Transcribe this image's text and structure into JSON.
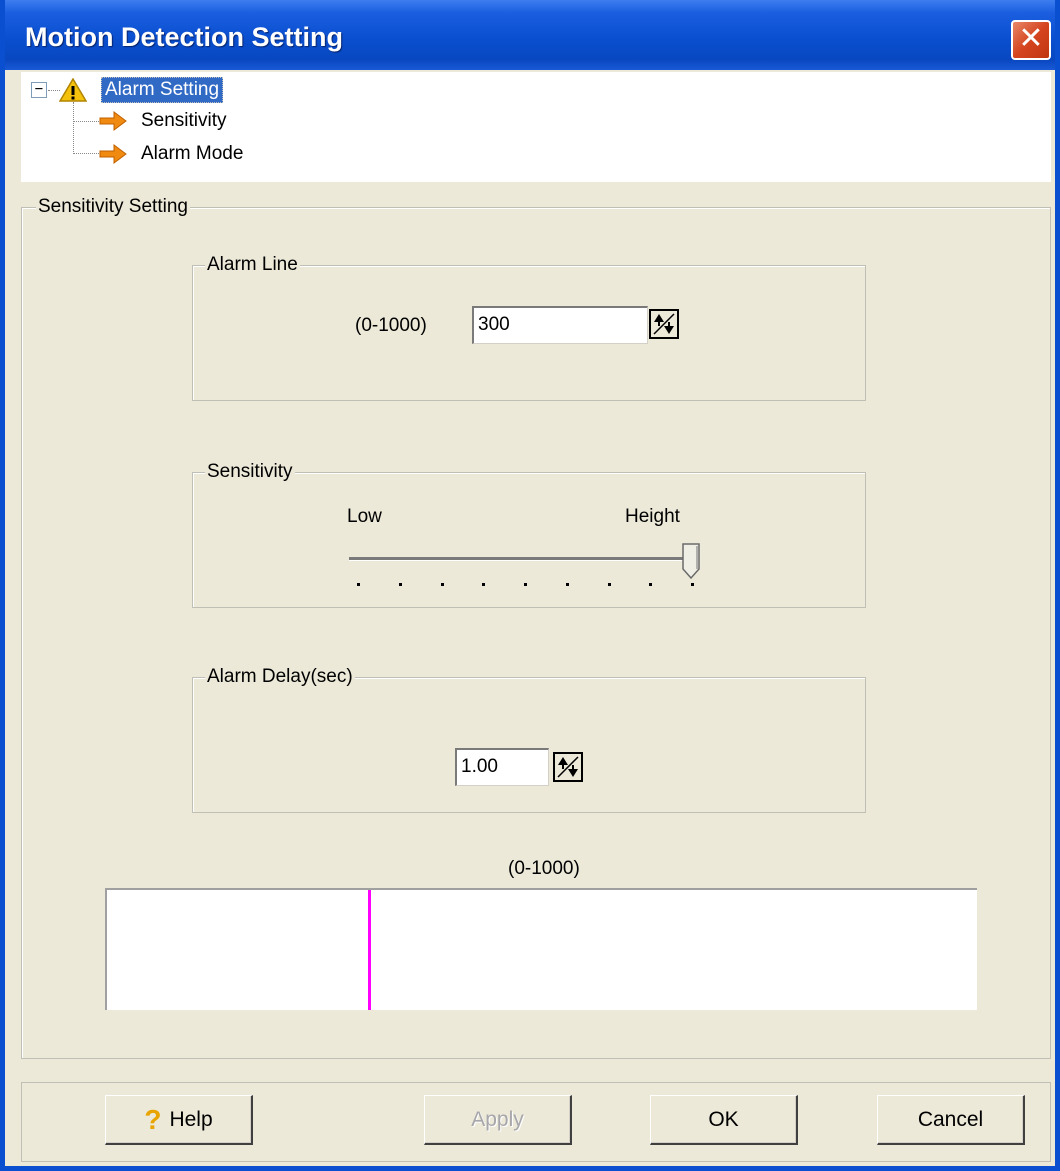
{
  "window": {
    "title": "Motion Detection Setting",
    "close_label": "✕"
  },
  "tree": {
    "expand_symbol": "−",
    "root": {
      "label": "Alarm Setting",
      "icon": "warning-icon"
    },
    "children": [
      {
        "label": "Sensitivity",
        "icon": "arrow-right-icon"
      },
      {
        "label": "Alarm Mode",
        "icon": "arrow-right-icon"
      }
    ]
  },
  "sensitivity_setting": {
    "title": "Sensitivity Setting",
    "alarm_line": {
      "label": "Alarm Line",
      "range": "(0-1000)",
      "value": "300"
    },
    "sensitivity": {
      "label": "Sensitivity",
      "low": "Low",
      "high": "Height",
      "level": 1.0,
      "ticks": 9
    },
    "alarm_delay": {
      "label": "Alarm Delay(sec)",
      "value": "1.00"
    },
    "graph": {
      "range": "(0-1000)",
      "alarm_line_value": 300,
      "max": 1000
    }
  },
  "buttons": {
    "help": "Help",
    "apply": "Apply",
    "ok": "OK",
    "cancel": "Cancel"
  },
  "colors": {
    "title_bar": "#0a4fd0",
    "selection": "#316ac5",
    "alarm_line": "#ff00ff",
    "background": "#ece9d8"
  }
}
